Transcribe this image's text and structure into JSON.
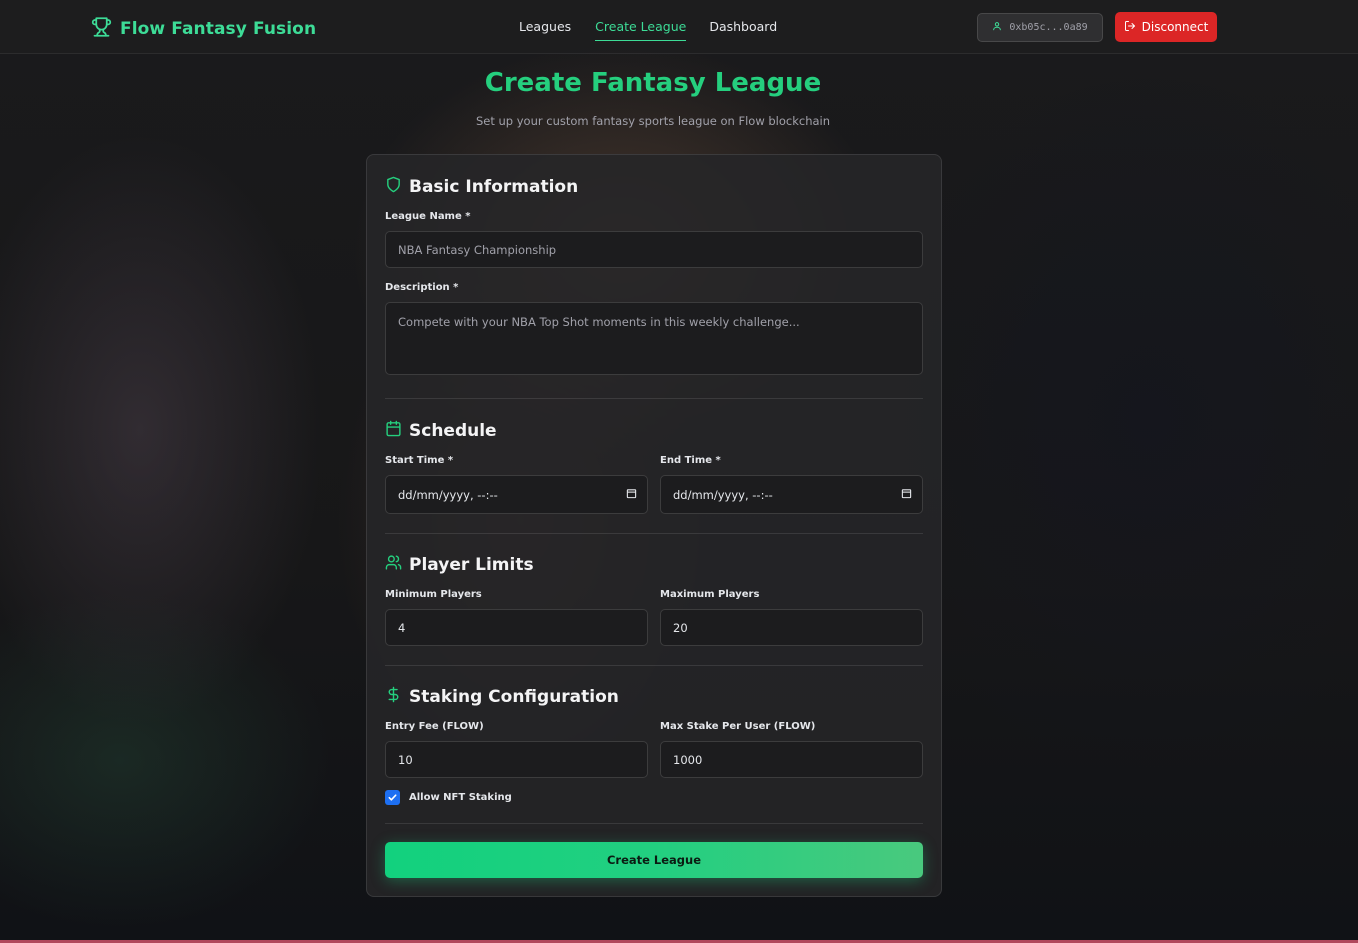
{
  "nav": {
    "brand": "Flow Fantasy Fusion",
    "links": [
      "Leagues",
      "Create League",
      "Dashboard"
    ],
    "active_link": "Create League",
    "wallet_address": "0xb05c...0a89",
    "disconnect_label": "Disconnect"
  },
  "page": {
    "title": "Create Fantasy League",
    "subtitle": "Set up your custom fantasy sports league on Flow blockchain"
  },
  "form": {
    "basic": {
      "title": "Basic Information",
      "league_name_label": "League Name *",
      "league_name_placeholder": "NBA Fantasy Championship",
      "description_label": "Description *",
      "description_placeholder": "Compete with your NBA Top Shot moments in this weekly challenge..."
    },
    "schedule": {
      "title": "Schedule",
      "start_label": "Start Time *",
      "start_value": "dd/mm/yyyy, --:--",
      "end_label": "End Time *",
      "end_value": "dd/mm/yyyy, --:--"
    },
    "players": {
      "title": "Player Limits",
      "min_label": "Minimum Players",
      "min_value": "4",
      "max_label": "Maximum Players",
      "max_value": "20"
    },
    "staking": {
      "title": "Staking Configuration",
      "entry_fee_label": "Entry Fee (FLOW)",
      "entry_fee_value": "10",
      "max_stake_label": "Max Stake Per User (FLOW)",
      "max_stake_value": "1000",
      "nft_label": "Allow NFT Staking",
      "nft_checked": true
    },
    "submit_label": "Create League"
  },
  "colors": {
    "accent": "#25cf7e",
    "danger": "#dc2626",
    "checkbox": "#1d6ff2"
  }
}
